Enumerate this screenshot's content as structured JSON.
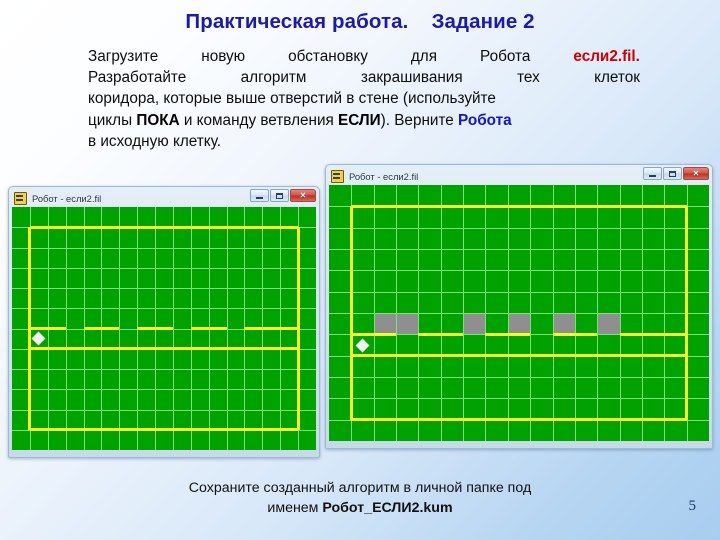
{
  "slide": {
    "title": "Практическая работа.    Задание 2",
    "page_number": "5",
    "background_accent": "#b6d5f2"
  },
  "body": {
    "line1_a": "Загрузите",
    "line1_b": "новую",
    "line1_c": "обстановку",
    "line1_d": "для",
    "line1_e": "Робота",
    "line1_file": "если2.fil.",
    "line2_a": "Разработайте",
    "line2_b": "алгоритм",
    "line2_c": "закрашивания",
    "line2_d": "тех",
    "line2_e": "клеток",
    "line3": "коридора,  которые выше отверстий в стене (используйте",
    "line4_a": "циклы ",
    "line4_kw1": "ПОКА",
    "line4_b": " и команду ветвления ",
    "line4_kw2": "ЕСЛИ",
    "line4_c": "). Верните ",
    "line4_robot": "Робота",
    "line5": "в исходную клетку."
  },
  "colors": {
    "title": "#1a1ab0",
    "file_red": "#cc0000",
    "robot_blue": "#1515c8",
    "field_green": "#00a200",
    "grid_line": "#7ee07e",
    "wall_yellow": "#fbfb22",
    "painted_gray": "#8f8f8f"
  },
  "window_left": {
    "title": "Робот - если2.fil",
    "minimize_label": "",
    "maximize_label": "",
    "close_label": "✕",
    "grid": {
      "cols": 17,
      "rows": 12
    },
    "robot_cell": {
      "col": 1,
      "row": 6
    },
    "painted_cells": []
  },
  "window_right": {
    "title": "Робот - если2.fil",
    "minimize_label": "",
    "maximize_label": "",
    "close_label": "✕",
    "grid": {
      "cols": 17,
      "rows": 12
    },
    "robot_cell": {
      "col": 1,
      "row": 7
    },
    "painted_cells": [
      {
        "col": 2,
        "row": 6
      },
      {
        "col": 3,
        "row": 6
      },
      {
        "col": 6,
        "row": 6
      },
      {
        "col": 8,
        "row": 6
      },
      {
        "col": 10,
        "row": 6
      },
      {
        "col": 12,
        "row": 6
      }
    ]
  },
  "caption": {
    "line1": "Сохраните созданный алгоритм в личной папке под",
    "line2_prefix": "именем ",
    "line2_file": "Робот_ЕСЛИ2.kum"
  }
}
